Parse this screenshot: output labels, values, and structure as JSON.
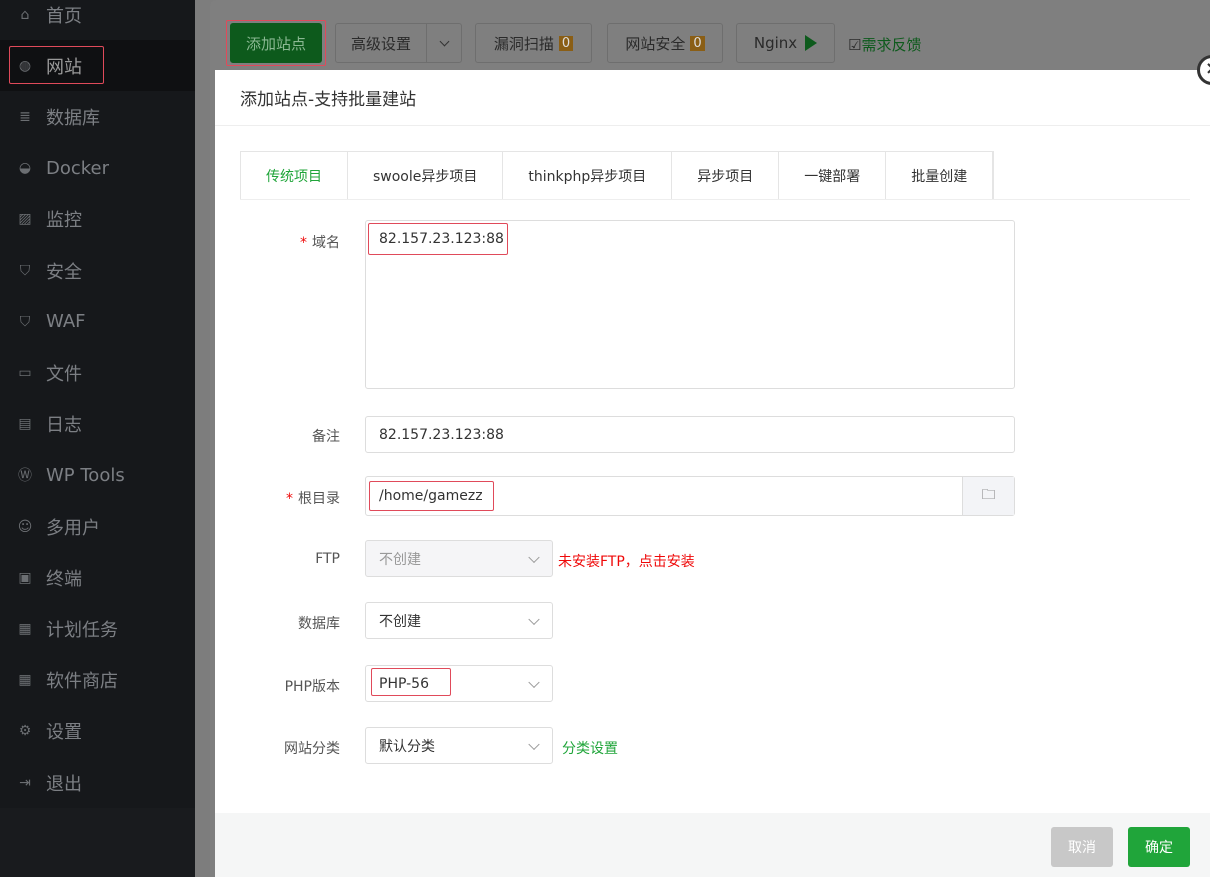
{
  "sidebar": {
    "items": [
      {
        "label": "首页",
        "icon": "home-icon"
      },
      {
        "label": "网站",
        "icon": "globe-icon"
      },
      {
        "label": "数据库",
        "icon": "database-icon"
      },
      {
        "label": "Docker",
        "icon": "docker-icon"
      },
      {
        "label": "监控",
        "icon": "monitor-icon"
      },
      {
        "label": "安全",
        "icon": "shield-icon"
      },
      {
        "label": "WAF",
        "icon": "waf-icon"
      },
      {
        "label": "文件",
        "icon": "folder-icon"
      },
      {
        "label": "日志",
        "icon": "log-icon"
      },
      {
        "label": "WP Tools",
        "icon": "wordpress-icon"
      },
      {
        "label": "多用户",
        "icon": "users-icon"
      },
      {
        "label": "终端",
        "icon": "terminal-icon"
      },
      {
        "label": "计划任务",
        "icon": "calendar-icon"
      },
      {
        "label": "软件商店",
        "icon": "apps-icon"
      },
      {
        "label": "设置",
        "icon": "gear-icon"
      },
      {
        "label": "退出",
        "icon": "logout-icon"
      }
    ]
  },
  "toolbar": {
    "add_site": "添加站点",
    "advanced": "高级设置",
    "vuln_scan": "漏洞扫描",
    "vuln_count": "0",
    "site_security": "网站安全",
    "security_count": "0",
    "nginx": "Nginx",
    "feedback": "需求反馈"
  },
  "modal": {
    "title": "添加站点-支持批量建站",
    "tabs": [
      "传统项目",
      "swoole异步项目",
      "thinkphp异步项目",
      "异步项目",
      "一键部署",
      "批量创建"
    ],
    "domain_label": "域名",
    "domain_value": "82.157.23.123:88",
    "remark_label": "备注",
    "remark_value": "82.157.23.123:88",
    "root_label": "根目录",
    "root_value": "/home/gamezz",
    "ftp_label": "FTP",
    "ftp_value": "不创建",
    "ftp_warning": "未安装FTP，点击安装",
    "db_label": "数据库",
    "db_value": "不创建",
    "php_label": "PHP版本",
    "php_value": "PHP-56",
    "category_label": "网站分类",
    "category_value": "默认分类",
    "category_settings": "分类设置",
    "cancel": "取消",
    "confirm": "确定"
  },
  "colors": {
    "accent": "#20a53a",
    "warning": "#ef0808",
    "highlight": "#e04a5a"
  }
}
